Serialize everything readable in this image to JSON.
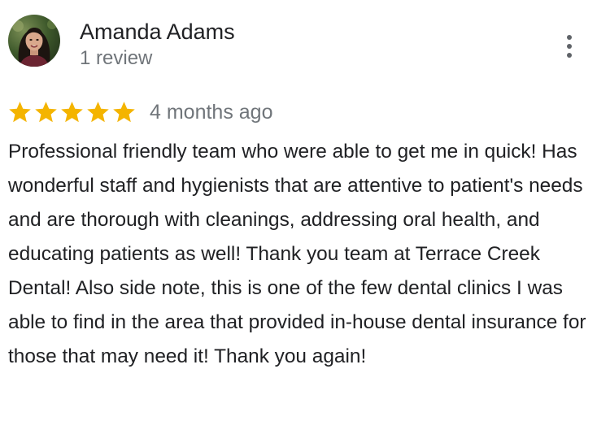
{
  "review": {
    "reviewer_name": "Amanda Adams",
    "reviewer_review_count": "1 review",
    "rating": 5,
    "rating_max": 5,
    "date": "4 months ago",
    "text": "Professional friendly team who were able to get me in quick! Has wonderful staff and hygienists that are attentive to patient's needs and are thorough with cleanings, addressing oral health, and educating patients as well! Thank you team at Terrace Creek Dental! Also side note, this is one of the few dental clinics I was able to find in the area that provided in-house dental insurance for those that may need it! Thank you again!"
  },
  "icons": {
    "avatar": "profile-photo",
    "menu": "more-vert-icon",
    "star": "star-icon"
  },
  "colors": {
    "star": "#f4b400",
    "name": "#202124",
    "secondary_text": "#70757a",
    "body_text": "#202124",
    "menu_icon": "#5f6368"
  }
}
